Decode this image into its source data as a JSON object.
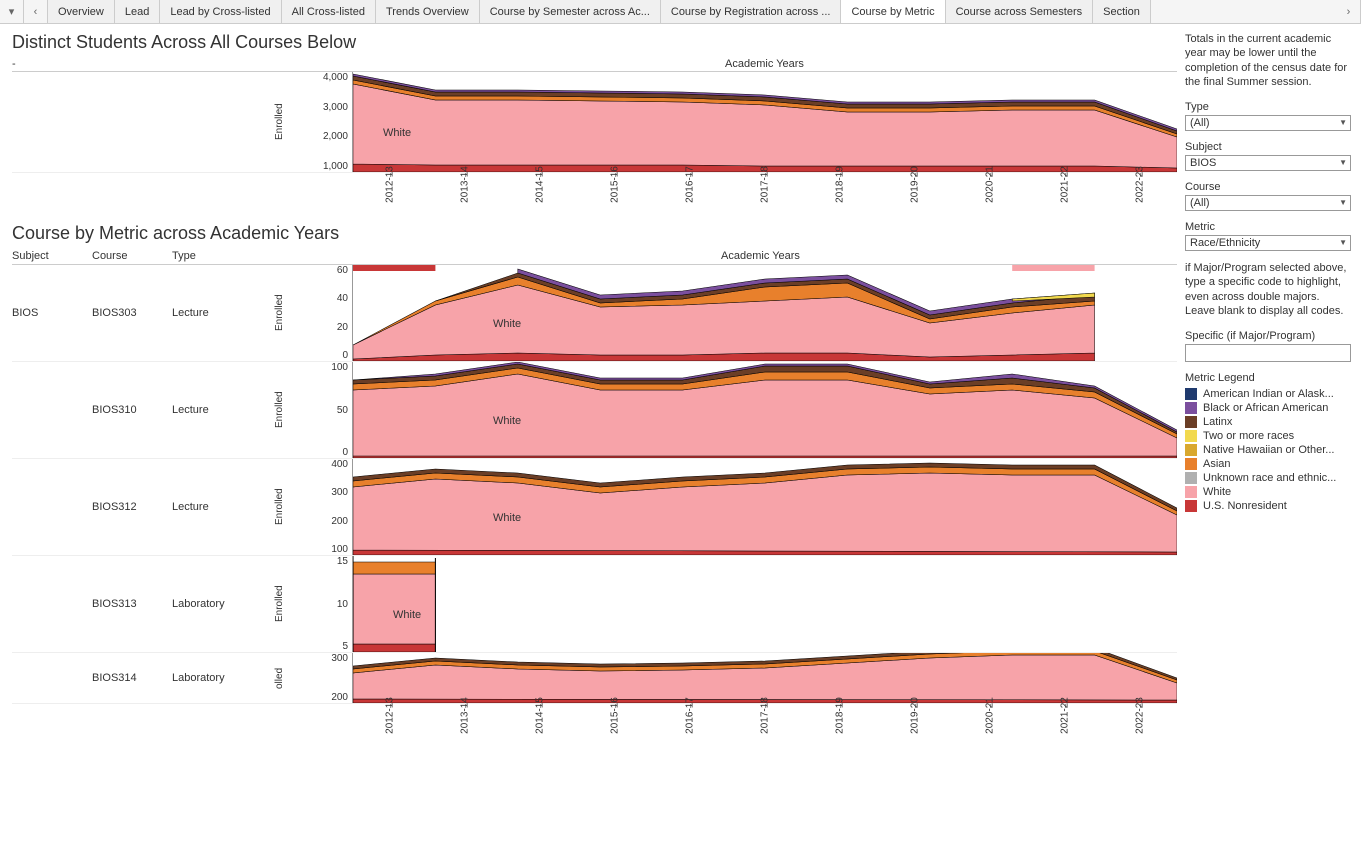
{
  "tabs": {
    "items": [
      "Overview",
      "Lead",
      "Lead by Cross-listed",
      "All Cross-listed",
      "Trends Overview",
      "Course by Semester across Ac...",
      "Course by Registration across ...",
      "Course by Metric",
      "Course across Semesters",
      "Section"
    ],
    "active": "Course by Metric"
  },
  "chart1": {
    "title": "Distinct Students Across All Courses Below",
    "dash": "-",
    "year_header": "Academic Years",
    "y_label": "Enrolled",
    "y_ticks": [
      "4,000",
      "3,000",
      "2,000",
      "1,000"
    ],
    "label_in_plot": "White"
  },
  "chart2": {
    "title": "Course by Metric across Academic Years",
    "col_headers": {
      "subject": "Subject",
      "course": "Course",
      "type": "Type"
    },
    "year_header": "Academic Years",
    "subject_value": "BIOS",
    "rows": [
      {
        "course": "BIOS303",
        "type": "Lecture",
        "y_label": "Enrolled",
        "y_ticks": [
          "60",
          "40",
          "20",
          "0"
        ],
        "label": "White"
      },
      {
        "course": "BIOS310",
        "type": "Lecture",
        "y_label": "Enrolled",
        "y_ticks": [
          "100",
          "50",
          "0"
        ],
        "label": "White"
      },
      {
        "course": "BIOS312",
        "type": "Lecture",
        "y_label": "Enrolled",
        "y_ticks": [
          "400",
          "300",
          "200",
          "100"
        ],
        "label": "White"
      },
      {
        "course": "BIOS313",
        "type": "Laboratory",
        "y_label": "Enrolled",
        "y_ticks": [
          "15",
          "10",
          "5"
        ],
        "label": "White"
      },
      {
        "course": "BIOS314",
        "type": "Laboratory",
        "y_label": "olled",
        "y_ticks": [
          "300",
          "200"
        ],
        "label": ""
      }
    ]
  },
  "x_categories": [
    "2012-13",
    "2013-14",
    "2014-15",
    "2015-16",
    "2016-17",
    "2017-18",
    "2018-19",
    "2019-20",
    "2020-21",
    "2021-22",
    "2022-23"
  ],
  "sidebar": {
    "note1": "Totals in the current academic year may be lower until the completion of the census date for the final Summer session.",
    "filters": {
      "type": {
        "label": "Type",
        "value": "(All)"
      },
      "subject": {
        "label": "Subject",
        "value": "BIOS"
      },
      "course": {
        "label": "Course",
        "value": "(All)"
      },
      "metric": {
        "label": "Metric",
        "value": "Race/Ethnicity"
      }
    },
    "note2": "if Major/Program selected above, type a specific code to highlight, even across double majors. Leave blank to display all codes.",
    "specific_label": "Specific (if Major/Program)",
    "specific_value": "",
    "legend_title": "Metric Legend",
    "legend": [
      {
        "label": "American Indian or Alask...",
        "color": "#1f3a6e"
      },
      {
        "label": "Black or African American",
        "color": "#7b4f9e"
      },
      {
        "label": "Latinx",
        "color": "#6b3e26"
      },
      {
        "label": "Two or more races",
        "color": "#f2d94e"
      },
      {
        "label": "Native Hawaiian or Other...",
        "color": "#d9a82e"
      },
      {
        "label": "Asian",
        "color": "#e8802c"
      },
      {
        "label": "Unknown race and ethnic...",
        "color": "#b0b0b0"
      },
      {
        "label": "White",
        "color": "#f7a3a9"
      },
      {
        "label": "U.S. Nonresident",
        "color": "#c83737"
      }
    ]
  },
  "chart_data": [
    {
      "type": "area",
      "title": "Distinct Students Across All Courses Below",
      "xlabel": "Academic Years",
      "ylabel": "Enrolled",
      "ylim": [
        0,
        4200
      ],
      "x": [
        "2012-13",
        "2013-14",
        "2014-15",
        "2015-16",
        "2016-17",
        "2017-18",
        "2018-19",
        "2019-20",
        "2020-21",
        "2021-22",
        "2022-23"
      ],
      "series": [
        {
          "name": "U.S. Nonresident",
          "values": [
            350,
            300,
            280,
            280,
            280,
            270,
            260,
            250,
            240,
            240,
            170
          ]
        },
        {
          "name": "White",
          "values": [
            3350,
            2500,
            2500,
            2450,
            2400,
            2300,
            2050,
            2050,
            2100,
            2100,
            1200
          ]
        },
        {
          "name": "Unknown race and ethnicity",
          "values": [
            60,
            50,
            50,
            50,
            50,
            45,
            40,
            40,
            40,
            40,
            25
          ]
        },
        {
          "name": "Asian",
          "values": [
            150,
            120,
            120,
            115,
            110,
            105,
            100,
            95,
            95,
            95,
            60
          ]
        },
        {
          "name": "Native Hawaiian or Other",
          "values": [
            15,
            12,
            12,
            12,
            10,
            10,
            10,
            10,
            10,
            10,
            6
          ]
        },
        {
          "name": "Two or more races",
          "values": [
            60,
            50,
            50,
            50,
            48,
            45,
            42,
            42,
            42,
            42,
            28
          ]
        },
        {
          "name": "Latinx",
          "values": [
            120,
            95,
            95,
            92,
            90,
            85,
            80,
            78,
            78,
            78,
            48
          ]
        },
        {
          "name": "Black or African American",
          "values": [
            80,
            65,
            65,
            62,
            60,
            58,
            55,
            52,
            52,
            52,
            32
          ]
        },
        {
          "name": "American Indian or Alaska Native",
          "values": [
            15,
            12,
            12,
            12,
            10,
            10,
            10,
            10,
            10,
            10,
            6
          ]
        }
      ]
    },
    {
      "type": "area",
      "title": "BIOS303 Lecture",
      "xlabel": "Academic Years",
      "ylabel": "Enrolled",
      "ylim": [
        0,
        65
      ],
      "x": [
        "2012-13",
        "2013-14",
        "2014-15",
        "2015-16",
        "2016-17",
        "2017-18",
        "2018-19",
        "2019-20",
        "2020-21",
        "2021-22",
        "2022-23"
      ],
      "series": [
        {
          "name": "U.S. Nonresident",
          "values": [
            2,
            3,
            4,
            3,
            3,
            3,
            3,
            2,
            2,
            3,
            0
          ]
        },
        {
          "name": "White",
          "values": [
            10,
            35,
            48,
            35,
            37,
            38,
            40,
            26,
            32,
            35,
            0
          ]
        },
        {
          "name": "Asian",
          "values": [
            0,
            2,
            4,
            3,
            3,
            8,
            8,
            2,
            4,
            2,
            0
          ]
        },
        {
          "name": "Two or more races",
          "values": [
            0,
            0,
            2,
            1,
            1,
            1,
            2,
            1,
            2,
            4,
            0
          ]
        },
        {
          "name": "Latinx",
          "values": [
            0,
            3,
            4,
            2,
            2,
            3,
            3,
            1,
            2,
            2,
            0
          ]
        },
        {
          "name": "Black or African American",
          "values": [
            0,
            2,
            3,
            1,
            1,
            2,
            2,
            1,
            1,
            1,
            0
          ]
        }
      ]
    },
    {
      "type": "area",
      "title": "BIOS310 Lecture",
      "xlabel": "Academic Years",
      "ylabel": "Enrolled",
      "ylim": [
        0,
        130
      ],
      "x": [
        "2012-13",
        "2013-14",
        "2014-15",
        "2015-16",
        "2016-17",
        "2017-18",
        "2018-19",
        "2019-20",
        "2020-21",
        "2021-22",
        "2022-23"
      ],
      "series": [
        {
          "name": "U.S. Nonresident",
          "values": [
            8,
            8,
            9,
            7,
            7,
            8,
            8,
            7,
            7,
            7,
            3
          ]
        },
        {
          "name": "White",
          "values": [
            80,
            85,
            100,
            80,
            80,
            95,
            95,
            75,
            80,
            70,
            25
          ]
        },
        {
          "name": "Asian",
          "values": [
            5,
            6,
            8,
            5,
            5,
            7,
            7,
            5,
            5,
            5,
            2
          ]
        },
        {
          "name": "Two or more races",
          "values": [
            2,
            2,
            3,
            2,
            2,
            3,
            3,
            2,
            2,
            2,
            1
          ]
        },
        {
          "name": "Latinx",
          "values": [
            4,
            4,
            5,
            3,
            3,
            5,
            5,
            3,
            4,
            4,
            1
          ]
        },
        {
          "name": "Black or African American",
          "values": [
            3,
            3,
            5,
            3,
            3,
            7,
            7,
            3,
            5,
            3,
            1
          ]
        }
      ]
    },
    {
      "type": "area",
      "title": "BIOS312 Lecture",
      "xlabel": "Academic Years",
      "ylabel": "Enrolled",
      "ylim": [
        0,
        400
      ],
      "x": [
        "2012-13",
        "2013-14",
        "2014-15",
        "2015-16",
        "2016-17",
        "2017-18",
        "2018-19",
        "2019-20",
        "2020-21",
        "2021-22",
        "2022-23"
      ],
      "series": [
        {
          "name": "U.S. Nonresident",
          "values": [
            25,
            28,
            25,
            22,
            24,
            26,
            28,
            30,
            30,
            30,
            15
          ]
        },
        {
          "name": "White",
          "values": [
            250,
            280,
            260,
            230,
            250,
            270,
            300,
            310,
            300,
            300,
            150
          ]
        },
        {
          "name": "Asian",
          "values": [
            15,
            18,
            15,
            13,
            15,
            16,
            18,
            20,
            18,
            18,
            9
          ]
        },
        {
          "name": "Latinx",
          "values": [
            12,
            14,
            13,
            11,
            12,
            13,
            15,
            16,
            15,
            15,
            7
          ]
        },
        {
          "name": "Black or African American",
          "values": [
            8,
            10,
            9,
            8,
            9,
            9,
            10,
            11,
            10,
            10,
            5
          ]
        }
      ]
    },
    {
      "type": "area",
      "title": "BIOS313 Laboratory",
      "xlabel": "Academic Years",
      "ylabel": "Enrolled",
      "ylim": [
        0,
        18
      ],
      "x": [
        "2012-13",
        "2013-14"
      ],
      "series": [
        {
          "name": "U.S. Nonresident",
          "values": [
            2,
            2
          ]
        },
        {
          "name": "White",
          "values": [
            12,
            12
          ]
        },
        {
          "name": "Asian",
          "values": [
            2,
            2
          ]
        }
      ]
    },
    {
      "type": "area",
      "title": "BIOS314 Laboratory",
      "xlabel": "Academic Years",
      "ylabel": "Enrolled",
      "ylim": [
        0,
        330
      ],
      "x": [
        "2012-13",
        "2013-14",
        "2014-15",
        "2015-16",
        "2016-17",
        "2017-18",
        "2018-19",
        "2019-20",
        "2020-21",
        "2021-22",
        "2022-23"
      ],
      "series": [
        {
          "name": "U.S. Nonresident",
          "values": [
            18,
            22,
            20,
            18,
            19,
            20,
            22,
            24,
            26,
            26,
            16
          ]
        },
        {
          "name": "White",
          "values": [
            190,
            225,
            205,
            195,
            200,
            210,
            235,
            260,
            280,
            280,
            170
          ]
        },
        {
          "name": "Asian",
          "values": [
            10,
            12,
            11,
            10,
            11,
            11,
            13,
            14,
            15,
            15,
            9
          ]
        },
        {
          "name": "Latinx",
          "values": [
            8,
            10,
            9,
            8,
            9,
            9,
            10,
            11,
            12,
            12,
            7
          ]
        }
      ]
    }
  ]
}
